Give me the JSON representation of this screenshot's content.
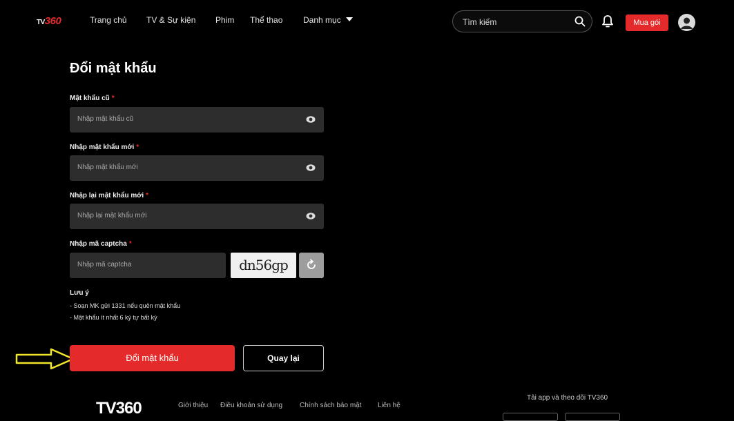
{
  "header": {
    "logo_tv": "TV",
    "logo_num": "360",
    "nav": [
      "Trang chủ",
      "TV & Sự kiện",
      "Phim",
      "Thể thao",
      "Danh mục"
    ],
    "search_placeholder": "Tìm kiếm",
    "buy_label": "Mua gói"
  },
  "form": {
    "title": "Đổi mật khẩu",
    "old_label": "Mật khẩu cũ",
    "old_placeholder": "Nhập mật khẩu cũ",
    "new_label": "Nhập mật khẩu mới",
    "new_placeholder": "Nhập mật khẩu mới",
    "confirm_label": "Nhập lại mật khẩu mới",
    "confirm_placeholder": "Nhập lại mật khẩu mới",
    "captcha_label": "Nhập mã captcha",
    "captcha_placeholder": "Nhập mã captcha",
    "captcha_text": "dn56gp",
    "required_mark": "*",
    "note_title": "Lưu ý",
    "notes": [
      "- Soạn MK gửi 1331 nếu quên mật khẩu",
      "- Mật khẩu ít nhất 6 ký tự bất kỳ"
    ],
    "submit_label": "Đổi mật khẩu",
    "back_label": "Quay lại"
  },
  "footer": {
    "logo": "TV360",
    "links": [
      "Giới thiệu",
      "Điều khoản sử dụng",
      "Chính sách bảo mật",
      "Liên hệ"
    ],
    "app_text": "Tải app và theo dõi TV360"
  },
  "colors": {
    "accent": "#e42a2a",
    "field_bg": "#2d2d2d",
    "arrow": "#f2e62b"
  }
}
